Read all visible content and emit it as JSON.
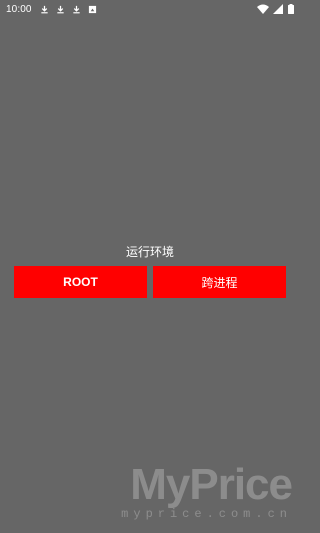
{
  "status_bar": {
    "time": "10:00",
    "notification_icons": [
      "download-icon",
      "download-icon",
      "download-icon",
      "screenshot-icon"
    ],
    "right_icons": [
      "wifi-icon",
      "signal-icon",
      "battery-icon"
    ]
  },
  "main": {
    "title": "运行环境",
    "buttons": {
      "root_label": "ROOT",
      "cross_process_label": "跨进程"
    }
  },
  "watermark": {
    "main": "MyPrice",
    "sub": "myprice.com.cn"
  },
  "colors": {
    "background": "#666666",
    "button": "#ff0000",
    "text": "#ffffff"
  }
}
